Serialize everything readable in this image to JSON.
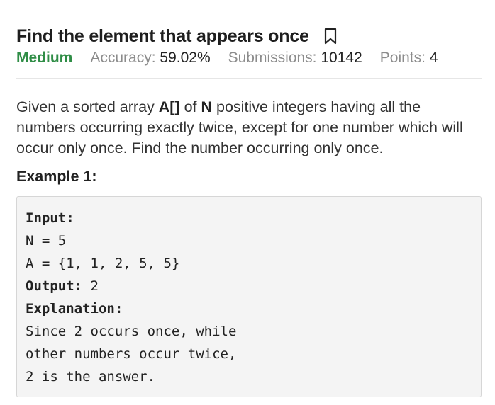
{
  "problem": {
    "title": "Find the element that appears once",
    "difficulty": "Medium",
    "accuracy_label": "Accuracy:",
    "accuracy_value": "59.02%",
    "submissions_label": "Submissions:",
    "submissions_value": "10142",
    "points_label": "Points:",
    "points_value": "4"
  },
  "statement": {
    "part1": "Given a sorted array ",
    "array_name": "A[]",
    "part2": " of ",
    "n_name": "N",
    "part3": " positive integers having all the numbers occurring exactly twice, except for one number which will occur only once. Find the number occurring only once."
  },
  "example": {
    "heading": "Example 1:",
    "input_label": "Input:",
    "input_lines": [
      "N = 5",
      "A = {1, 1, 2, 5, 5}"
    ],
    "output_label": "Output:",
    "output_value": " 2",
    "explanation_label": "Explanation:",
    "explanation_lines": [
      "Since 2 occurs once, while",
      "other numbers occur twice,",
      "2 is the answer."
    ]
  },
  "colors": {
    "difficulty_green": "#2f8d46",
    "meta_gray": "#8c8c8c",
    "code_background": "#f4f4f4"
  },
  "icons": {
    "bookmark": "bookmark-icon"
  }
}
